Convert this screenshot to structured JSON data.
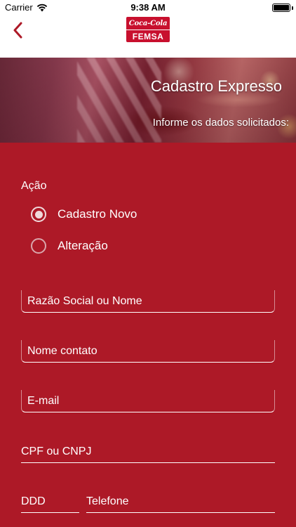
{
  "status_bar": {
    "carrier": "Carrier",
    "time": "9:38 AM"
  },
  "nav": {
    "logo_top": "Coca-Cola",
    "logo_bottom": "FEMSA"
  },
  "hero": {
    "title": "Cadastro Expresso",
    "subtitle": "Informe os dados solicitados:"
  },
  "form": {
    "action_label": "Ação",
    "options": [
      {
        "label": "Cadastro Novo",
        "selected": true
      },
      {
        "label": "Alteração",
        "selected": false
      }
    ],
    "fields": {
      "razao_social": "Razão Social ou Nome",
      "nome_contato": "Nome contato",
      "email": "E-mail",
      "cpf_cnpj": "CPF ou CNPJ",
      "ddd": "DDD",
      "telefone": "Telefone"
    }
  },
  "colors": {
    "brand_red": "#ad1927",
    "logo_red": "#c8102e"
  }
}
